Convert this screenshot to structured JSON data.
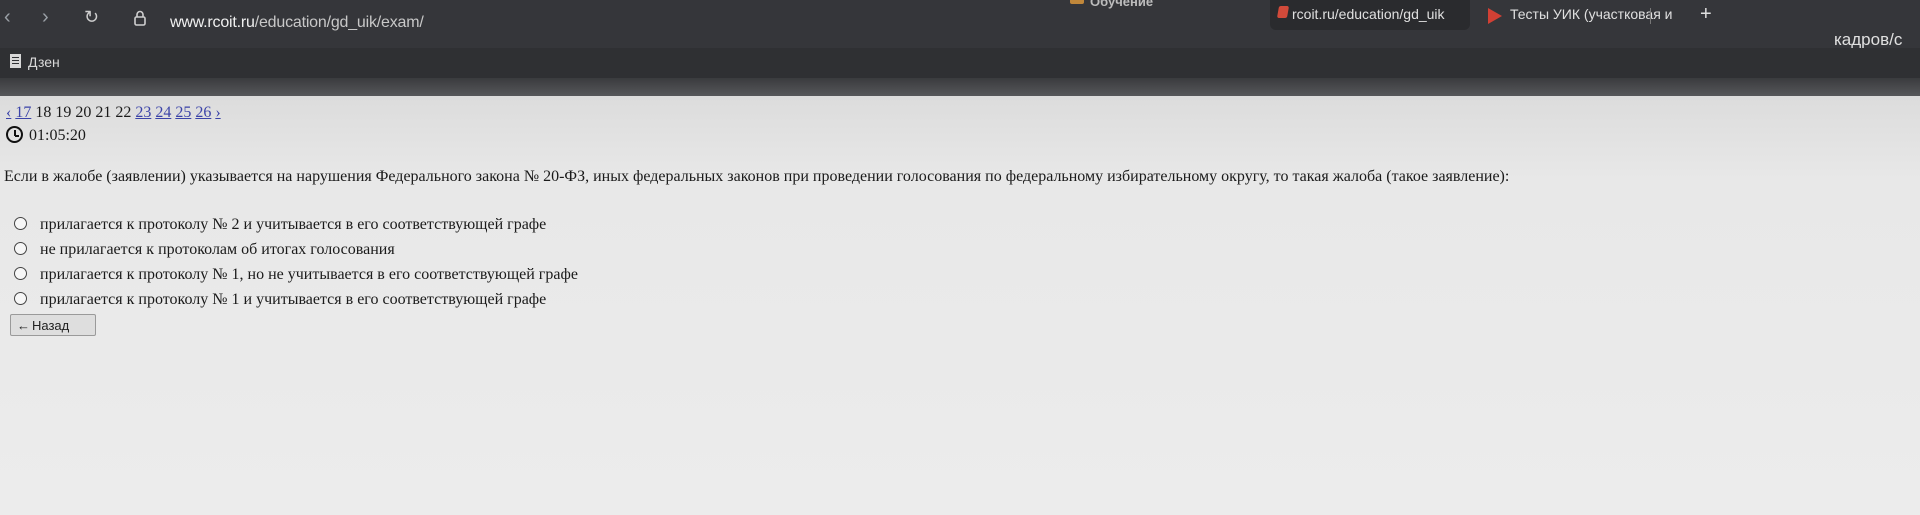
{
  "browser": {
    "url_host": "www.rcoit.ru",
    "url_path": "/education/gd_uik/exam/",
    "tab_cut_label": "Обучение",
    "tabs": [
      {
        "label": "rcoit.ru/education/gd_uik"
      },
      {
        "label": "Тесты УИК (участковая и"
      }
    ],
    "new_tab_label": "+",
    "profile_text": "кадров/с"
  },
  "bookmarks": [
    {
      "label": "Дзен"
    }
  ],
  "pager": {
    "prev": "‹",
    "items": [
      "17",
      "18",
      "19",
      "20",
      "21",
      "22",
      "23",
      "24",
      "25",
      "26"
    ],
    "next": "›"
  },
  "timer": "01:05:20",
  "question": "Если в жалобе (заявлении) указывается на нарушения Федерального закона № 20-ФЗ, иных федеральных законов при проведении голосования по федеральному избирательному округу, то такая жалоба (такое заявление):",
  "options": [
    "прилагается к протоколу № 2 и учитывается в его соответствующей графе",
    "не прилагается к протоколам об итогах голосования",
    "прилагается к протоколу № 1, но не учитывается в его соответствующей графе",
    "прилагается к протоколу № 1 и учитывается в его соответствующей графе"
  ],
  "back_button": "Назад"
}
